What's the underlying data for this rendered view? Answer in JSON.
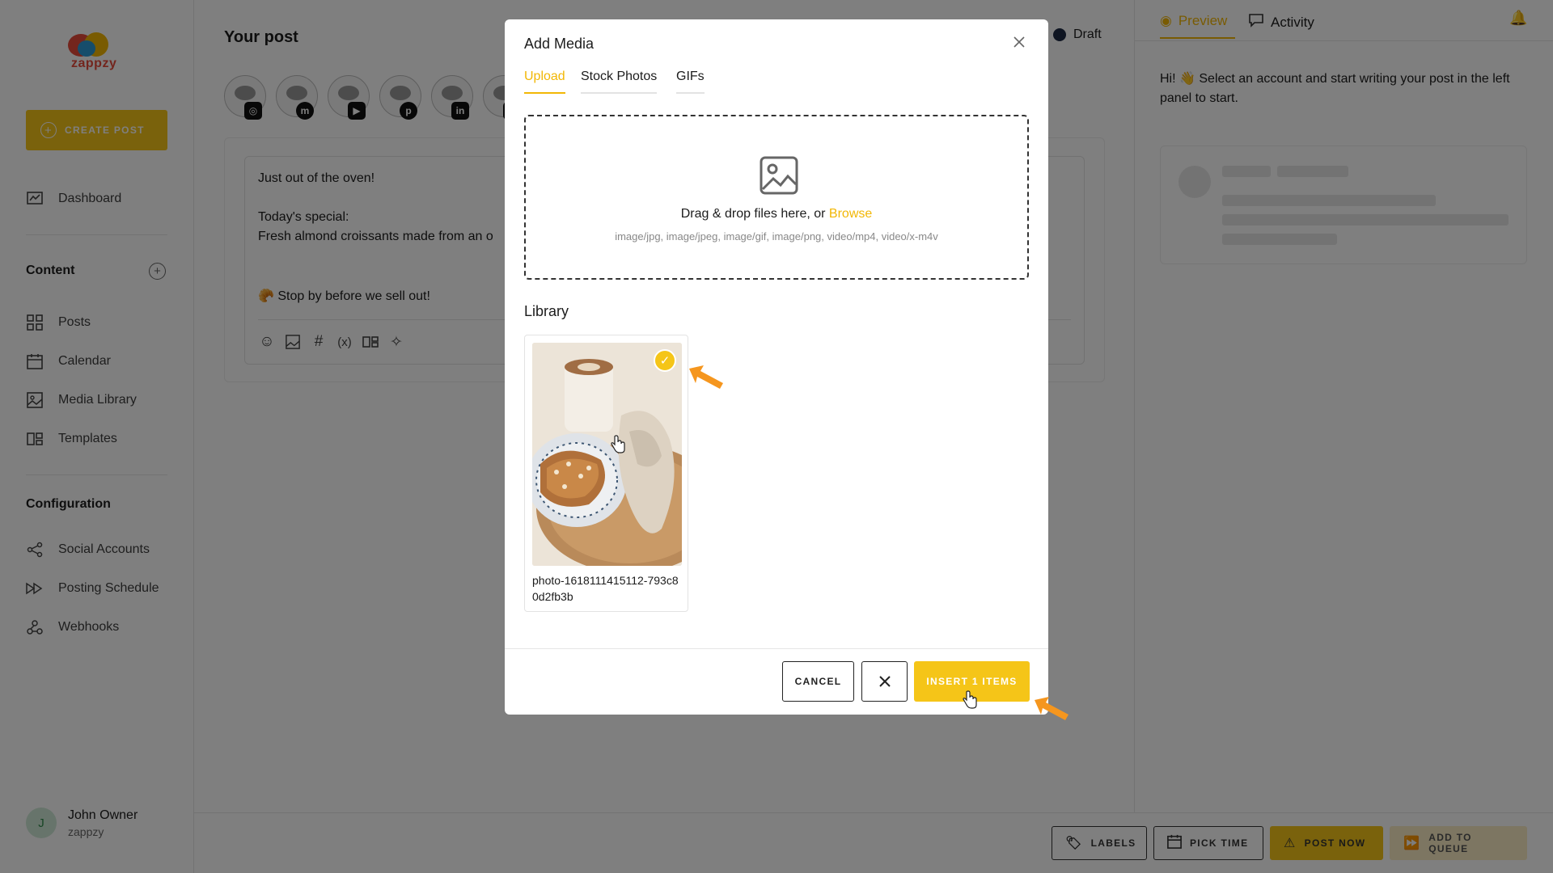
{
  "app": {
    "logo_text": "zappzy",
    "create_post_label": "CREATE POST",
    "nav": {
      "dashboard": "Dashboard",
      "content_heading": "Content",
      "posts": "Posts",
      "calendar": "Calendar",
      "media_library": "Media Library",
      "templates": "Templates",
      "configuration_heading": "Configuration",
      "social_accounts": "Social Accounts",
      "posting_schedule": "Posting Schedule",
      "webhooks": "Webhooks"
    },
    "user": {
      "initial": "J",
      "name": "John Owner",
      "org": "zappzy"
    }
  },
  "editor": {
    "title": "Your post",
    "status": "Draft",
    "accounts": [
      {
        "network": "instagram",
        "glyph": "◎"
      },
      {
        "network": "mastodon",
        "glyph": "m"
      },
      {
        "network": "youtube",
        "glyph": "▶"
      },
      {
        "network": "pinterest",
        "glyph": "p"
      },
      {
        "network": "linkedin",
        "glyph": "in"
      },
      {
        "network": "other",
        "glyph": "●"
      }
    ],
    "lines": [
      "Just out of the oven!",
      "Today's special:",
      "Fresh almond croissants made from an o",
      "🥐 Stop by before we sell out!"
    ],
    "toolbar_icons": [
      "emoji-icon",
      "image-icon",
      "hashtag-icon",
      "variable-icon",
      "template-icon",
      "ai-sparkle-icon"
    ]
  },
  "preview": {
    "tab_preview": "Preview",
    "tab_activity": "Activity",
    "message": "Hi! 👋 Select an account and start writing your post in the left panel to start."
  },
  "bottom_bar": {
    "labels": "LABELS",
    "pick_time": "PICK TIME",
    "post_now": "POST NOW",
    "add_to_queue": "ADD TO QUEUE"
  },
  "modal": {
    "title": "Add Media",
    "tabs": [
      "Upload",
      "Stock Photos",
      "GIFs"
    ],
    "active_tab": "Upload",
    "dropzone_text": "Drag & drop files here, or ",
    "browse_label": "Browse",
    "accepted_types": "image/jpg, image/jpeg, image/gif, image/png, video/mp4, video/x-m4v",
    "library_title": "Library",
    "library_items": [
      {
        "filename": "photo-1618111415112-793c80d2fb3b",
        "selected": true
      }
    ],
    "cancel_label": "CANCEL",
    "insert_label": "INSERT 1 ITEMS"
  },
  "colors": {
    "accent": "#f5c518",
    "annotation_arrow": "#f5961e",
    "overlay": "rgba(0,0,0,0.5)"
  }
}
